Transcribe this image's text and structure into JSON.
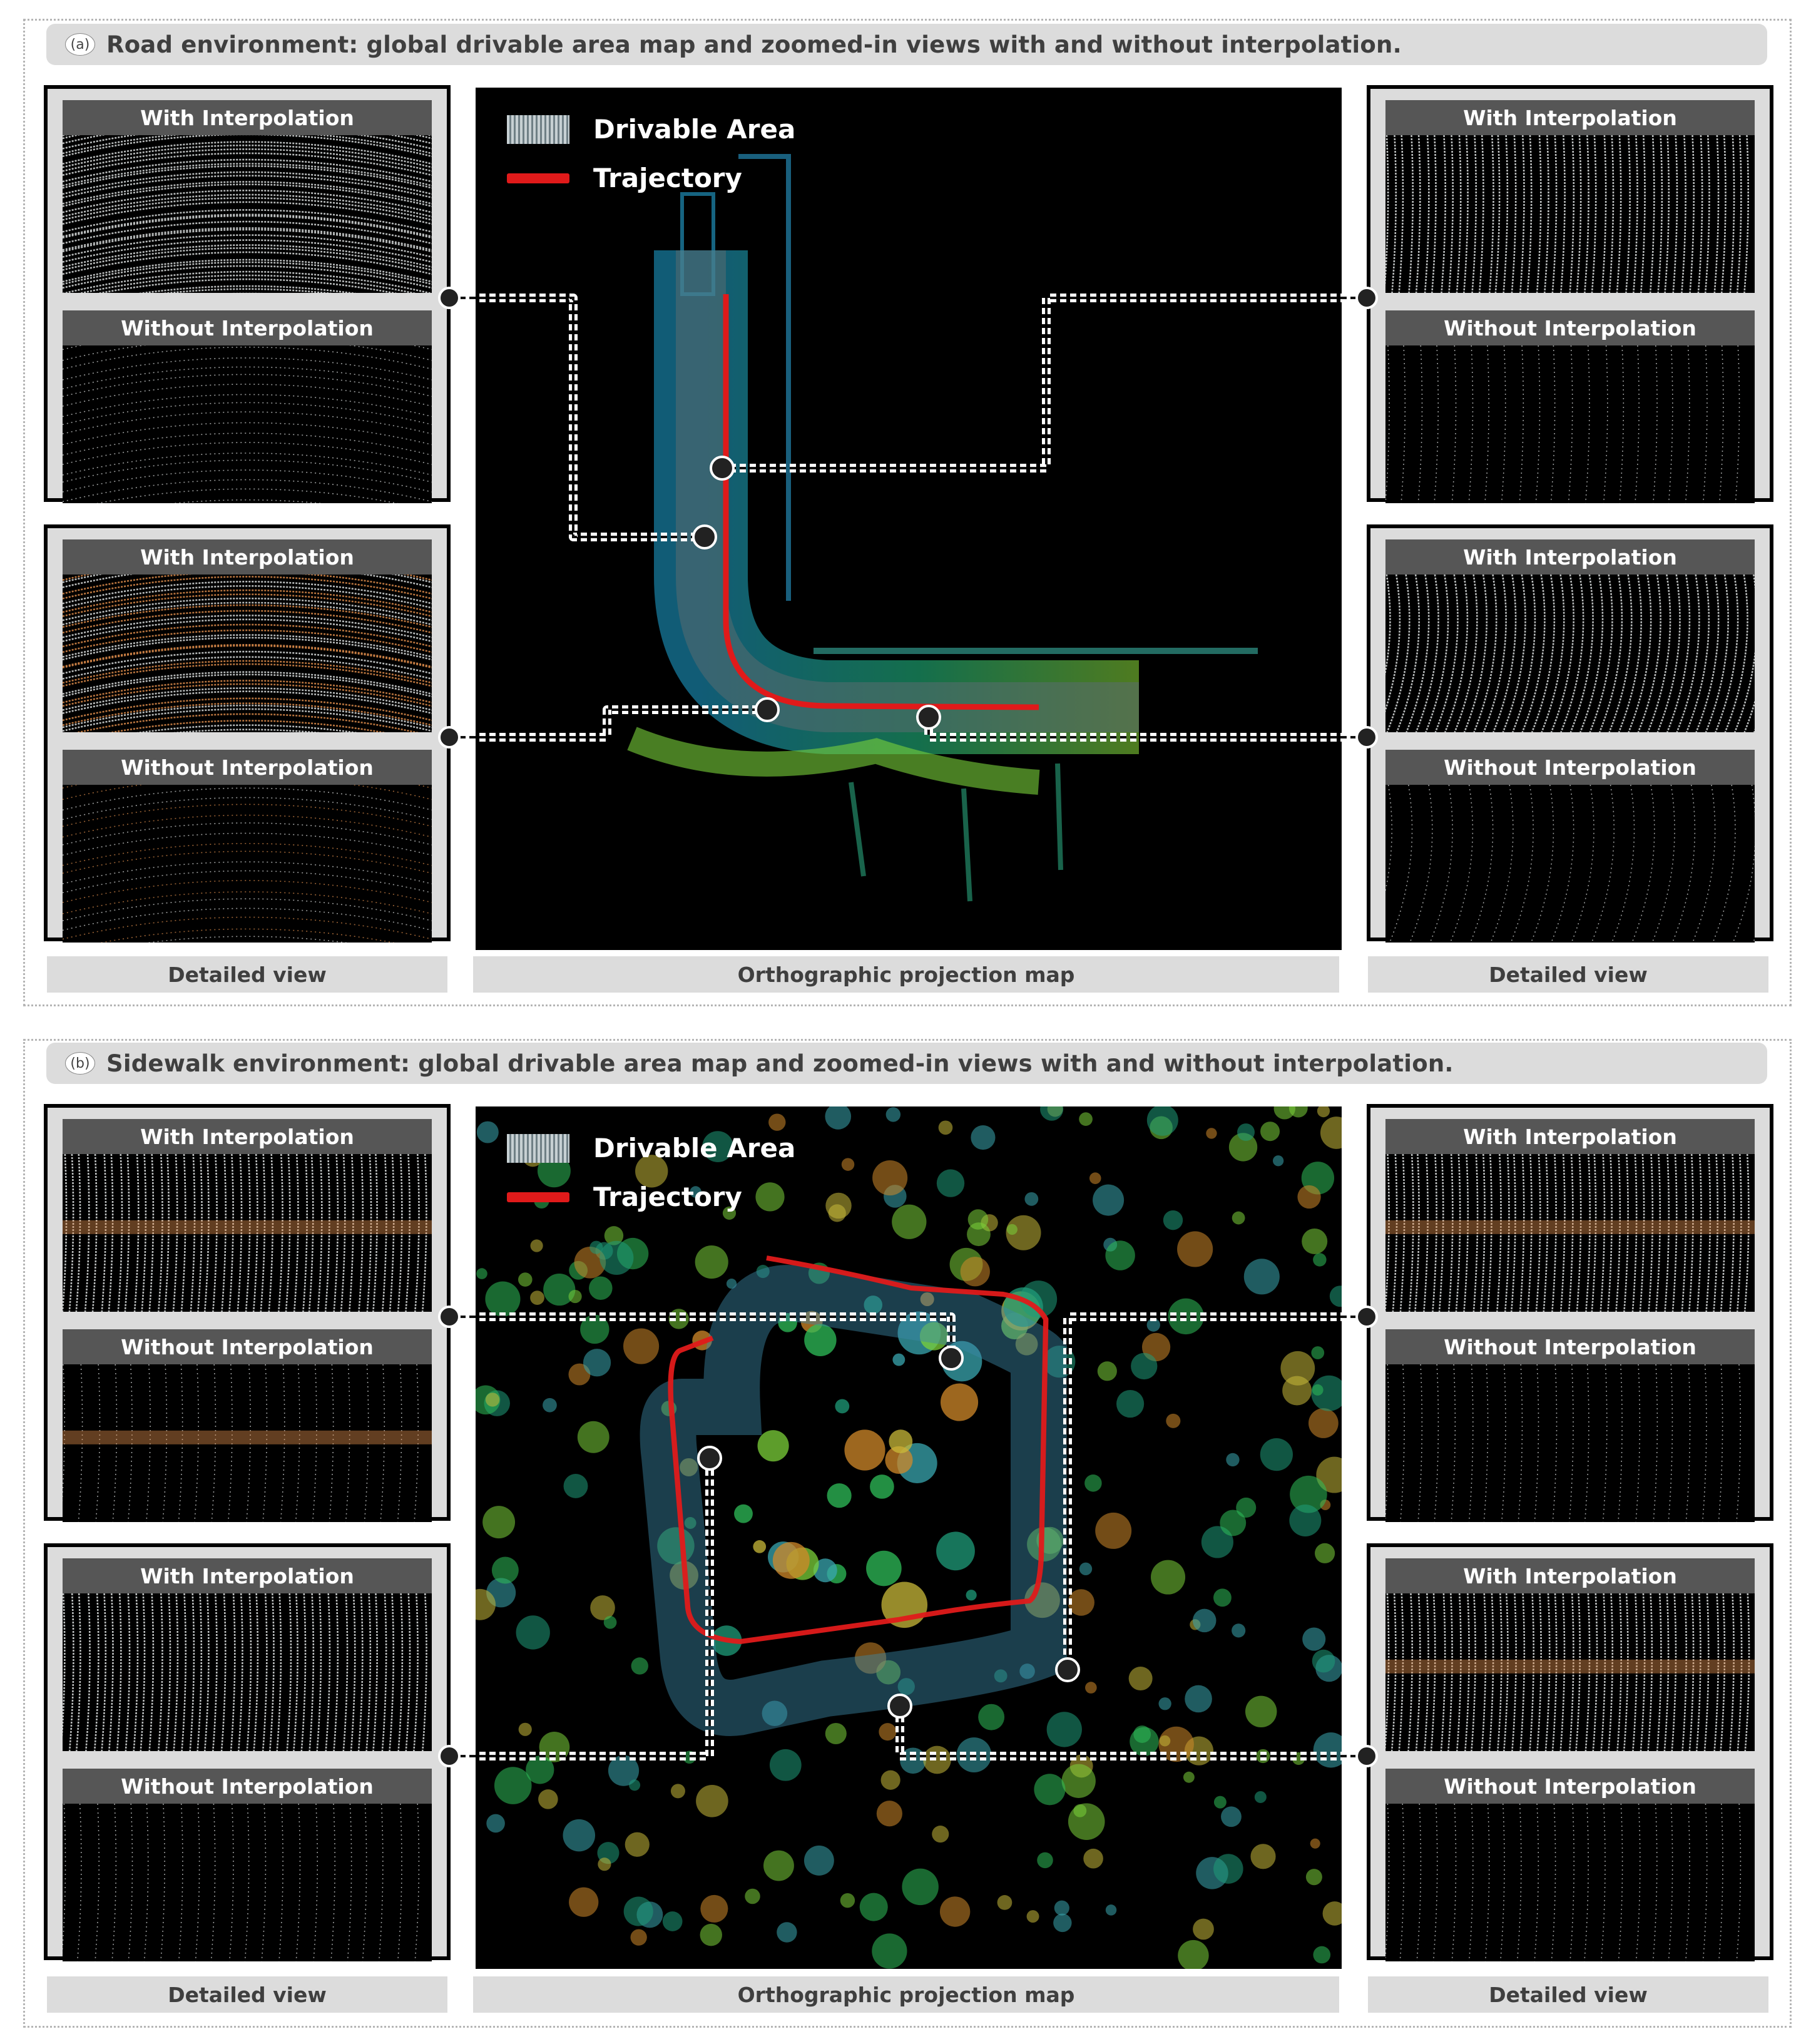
{
  "panels": [
    {
      "tag": "(a)",
      "caption": "Road environment: global drivable area map and zoomed-in views with and without interpolation.",
      "left_groups": [
        {
          "with_label": "With Interpolation",
          "without_label": "Without Interpolation"
        },
        {
          "with_label": "With Interpolation",
          "without_label": "Without Interpolation"
        }
      ],
      "right_groups": [
        {
          "with_label": "With Interpolation",
          "without_label": "Without Interpolation"
        },
        {
          "with_label": "With Interpolation",
          "without_label": "Without Interpolation"
        }
      ],
      "legend": {
        "area": "Drivable Area",
        "trajectory": "Trajectory"
      },
      "footers": {
        "left": "Detailed view",
        "center": "Orthographic projection map",
        "right": "Detailed view"
      }
    },
    {
      "tag": "(b)",
      "caption": "Sidewalk environment: global drivable area map and zoomed-in views with and without interpolation.",
      "left_groups": [
        {
          "with_label": "With Interpolation",
          "without_label": "Without Interpolation"
        },
        {
          "with_label": "With Interpolation",
          "without_label": "Without Interpolation"
        }
      ],
      "right_groups": [
        {
          "with_label": "With Interpolation",
          "without_label": "Without Interpolation"
        },
        {
          "with_label": "With Interpolation",
          "without_label": "Without Interpolation"
        }
      ],
      "legend": {
        "area": "Drivable Area",
        "trajectory": "Trajectory"
      },
      "footers": {
        "left": "Detailed view",
        "center": "Orthographic projection map",
        "right": "Detailed view"
      }
    }
  ],
  "colors": {
    "trajectory": "#e01a1a",
    "label_bar": "#565656",
    "caption_bg": "#dcdcdc",
    "points_orange": "#d98a4a",
    "points_white": "#d8dcdc"
  }
}
